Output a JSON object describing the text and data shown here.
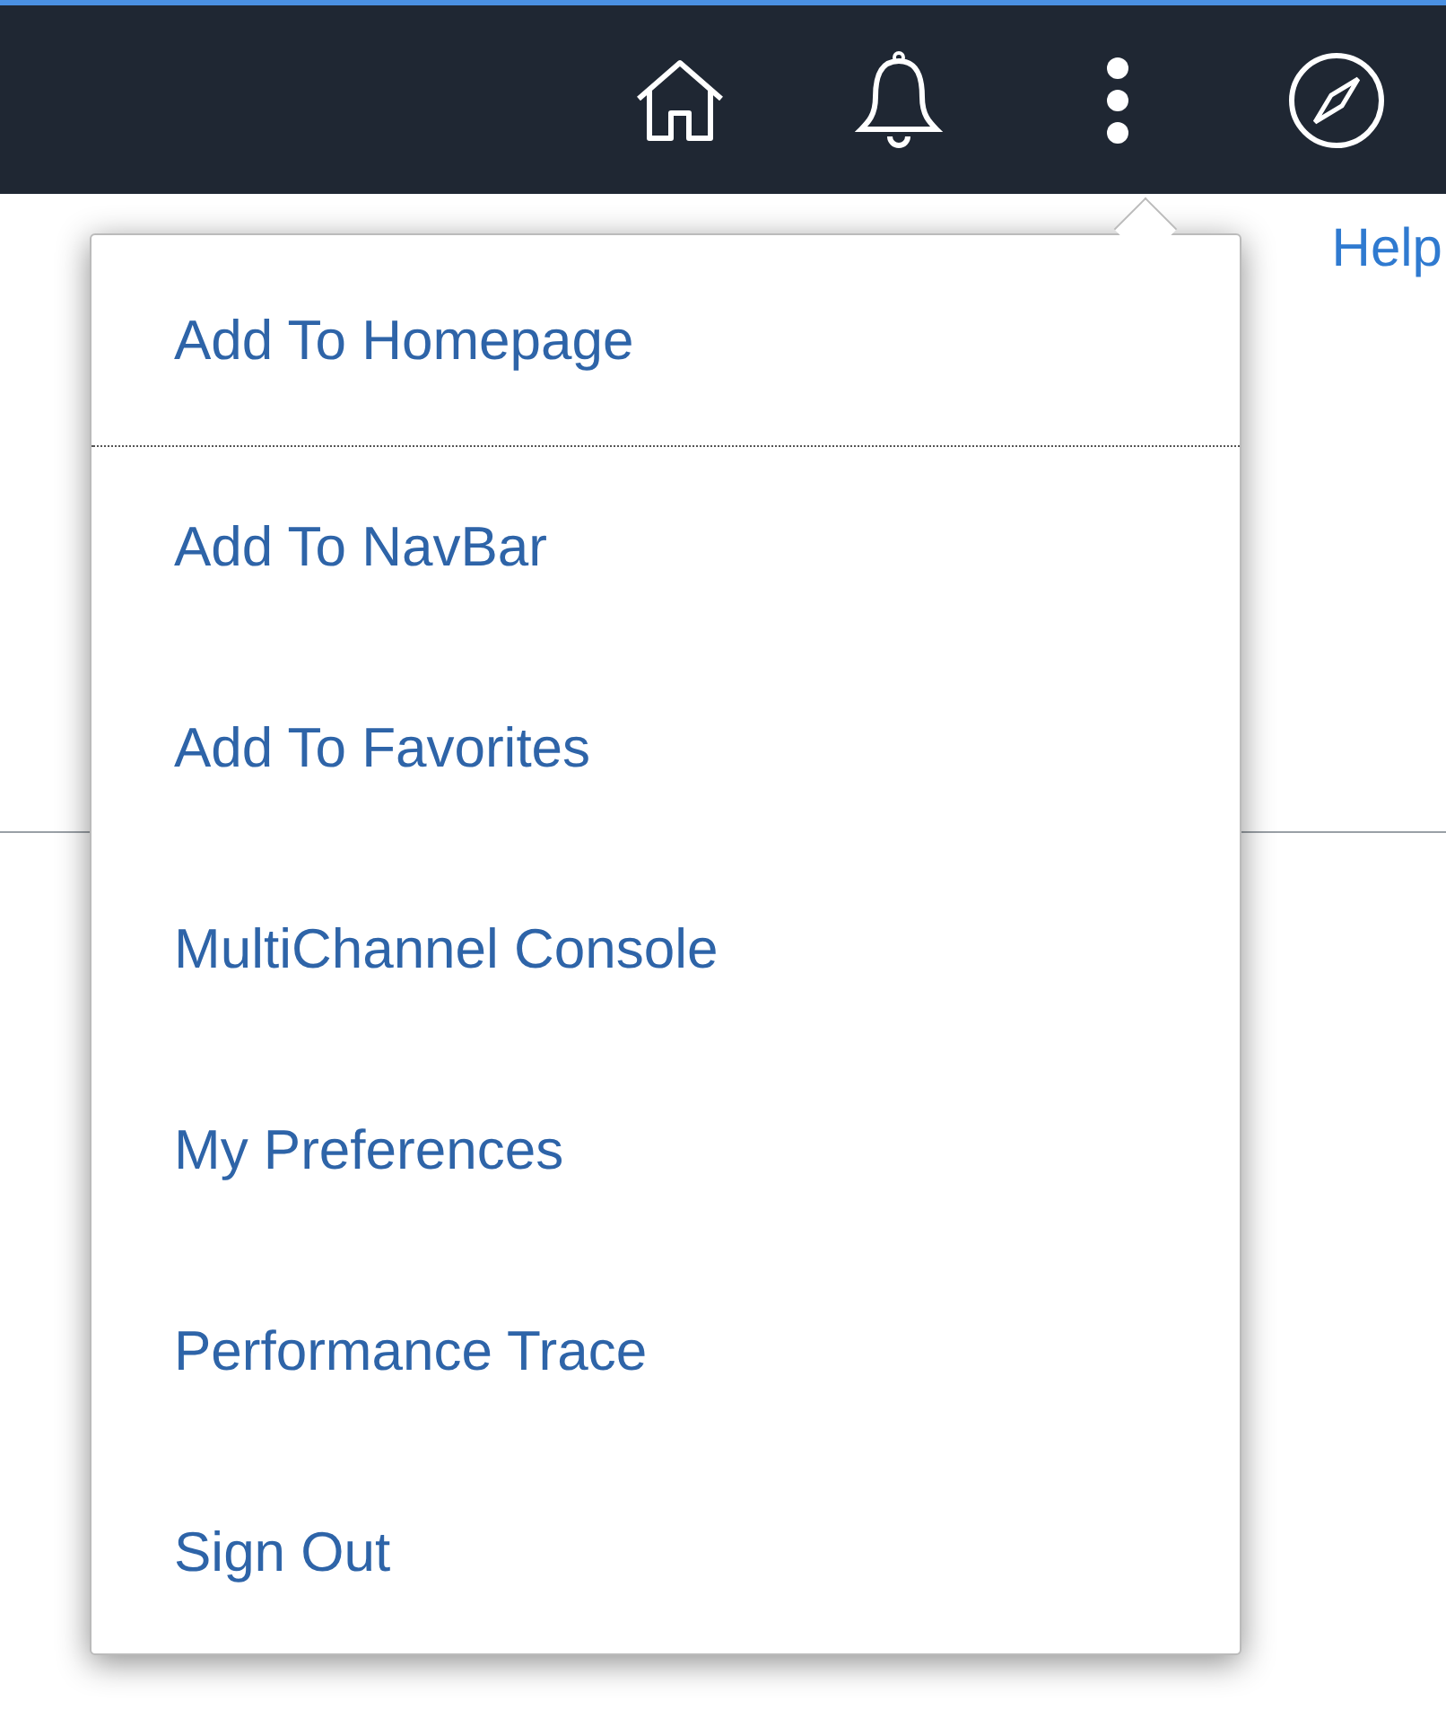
{
  "header": {
    "icons": [
      {
        "kind": "home"
      },
      {
        "kind": "bell"
      },
      {
        "kind": "more"
      },
      {
        "kind": "compass"
      }
    ]
  },
  "page": {
    "help_link": "Help"
  },
  "menu": {
    "items": [
      {
        "label": "Add To Homepage",
        "focused": true
      },
      {
        "label": "Add To NavBar",
        "focused": false
      },
      {
        "label": "Add To Favorites",
        "focused": false
      },
      {
        "label": "MultiChannel Console",
        "focused": false
      },
      {
        "label": "My Preferences",
        "focused": false
      },
      {
        "label": "Performance Trace",
        "focused": false
      },
      {
        "label": "Sign Out",
        "focused": false
      }
    ]
  }
}
